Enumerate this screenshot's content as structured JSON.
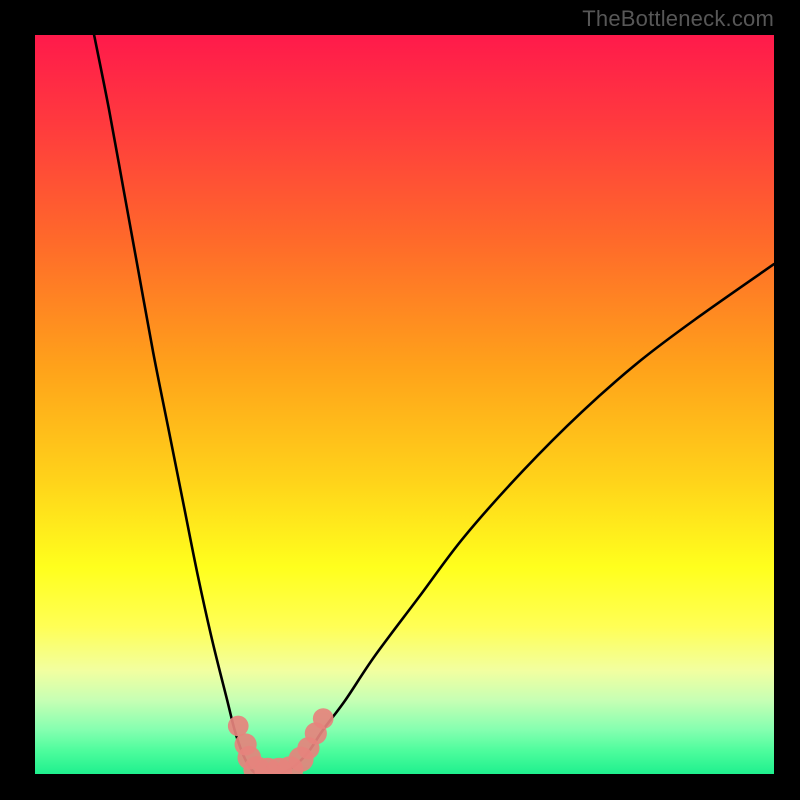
{
  "watermark": "TheBottleneck.com",
  "chart_data": {
    "type": "line",
    "title": "",
    "xlabel": "",
    "ylabel": "",
    "xlim": [
      0,
      100
    ],
    "ylim": [
      0,
      100
    ],
    "gradient_stops": [
      {
        "offset": 0.0,
        "color": "#ff1a4b"
      },
      {
        "offset": 0.12,
        "color": "#ff3a3e"
      },
      {
        "offset": 0.28,
        "color": "#ff6a2a"
      },
      {
        "offset": 0.45,
        "color": "#ffa21a"
      },
      {
        "offset": 0.6,
        "color": "#ffd21a"
      },
      {
        "offset": 0.72,
        "color": "#ffff1d"
      },
      {
        "offset": 0.8,
        "color": "#ffff55"
      },
      {
        "offset": 0.86,
        "color": "#f2ffa0"
      },
      {
        "offset": 0.9,
        "color": "#c7ffb4"
      },
      {
        "offset": 0.94,
        "color": "#85ffb0"
      },
      {
        "offset": 0.97,
        "color": "#4bfc9c"
      },
      {
        "offset": 1.0,
        "color": "#1ff08e"
      }
    ],
    "series": [
      {
        "name": "bottleneck-curve",
        "x": [
          8,
          10,
          12,
          14,
          16,
          18,
          20,
          22,
          24,
          26,
          27,
          28,
          29,
          30,
          31,
          33,
          35,
          37,
          39,
          42,
          46,
          52,
          58,
          66,
          74,
          82,
          90,
          100
        ],
        "y": [
          100,
          90,
          79,
          68,
          57,
          47,
          37,
          27,
          18,
          10,
          6,
          3,
          1,
          0,
          0,
          0,
          1,
          3,
          6,
          10,
          16,
          24,
          32,
          41,
          49,
          56,
          62,
          69
        ]
      }
    ],
    "markers": {
      "name": "highlight-points",
      "color": "#e6837d",
      "points": [
        {
          "x": 27.5,
          "y": 6.5,
          "r": 1.4
        },
        {
          "x": 28.5,
          "y": 4.0,
          "r": 1.5
        },
        {
          "x": 29.0,
          "y": 2.2,
          "r": 1.6
        },
        {
          "x": 30.0,
          "y": 0.6,
          "r": 1.8
        },
        {
          "x": 31.5,
          "y": 0.4,
          "r": 1.8
        },
        {
          "x": 33.0,
          "y": 0.4,
          "r": 1.8
        },
        {
          "x": 34.5,
          "y": 0.6,
          "r": 1.8
        },
        {
          "x": 36.0,
          "y": 2.0,
          "r": 1.7
        },
        {
          "x": 37.0,
          "y": 3.5,
          "r": 1.5
        },
        {
          "x": 38.0,
          "y": 5.5,
          "r": 1.5
        },
        {
          "x": 39.0,
          "y": 7.5,
          "r": 1.4
        }
      ]
    }
  }
}
